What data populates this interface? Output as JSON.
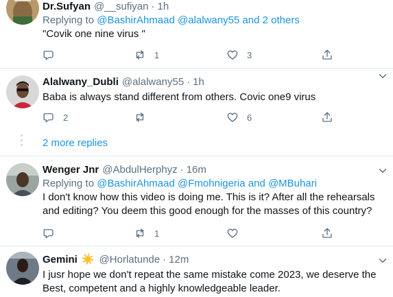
{
  "tweets": [
    {
      "name": "Dr.Sufyan",
      "handle": "@__sufiyan",
      "time": "1h",
      "replying_prefix": "Replying to ",
      "replying_users": "@BashirAhmaad @alalwany55 and 2 others",
      "text": "\"Covik one nine virus \"",
      "replies": "",
      "retweets": "1",
      "likes": "3"
    },
    {
      "name": "Alalwany_Dubli",
      "handle": "@alalwany55",
      "time": "1h",
      "text": "Baba is always stand different from others. Covic one9 virus",
      "replies": "2",
      "retweets": "",
      "likes": "6"
    },
    {
      "name": "Wenger Jnr",
      "handle": "@AbdulHerphyz",
      "time": "16m",
      "replying_prefix": "Replying to ",
      "replying_users": "@BashirAhmaad @Fmohnigeria and @MBuhari",
      "text_line1": "I don't know how this video is doing me. This is it? After all the rehearsals",
      "text_line2": "and editing? You deem this good enough for the masses of this country?",
      "replies": "",
      "retweets": "1",
      "likes": ""
    },
    {
      "name": "Gemini",
      "name_emoji": "☀️",
      "handle": "@Horlatunde",
      "time": "12m",
      "text_line1": "I jusr hope we don't repeat the same mistake come 2023, we deserve the",
      "text_line2": "Best, competent and a highly knowledgeable leader."
    }
  ],
  "more_replies": "2 more replies",
  "icons": {
    "reply": "reply-icon",
    "retweet": "retweet-icon",
    "like": "like-icon",
    "share": "share-icon",
    "more": "more-icon"
  },
  "colors": {
    "link": "#1b95e0",
    "secondary_text": "#5b7083",
    "divider": "#e6ecf0",
    "thread_line": "#ccd6dd"
  }
}
